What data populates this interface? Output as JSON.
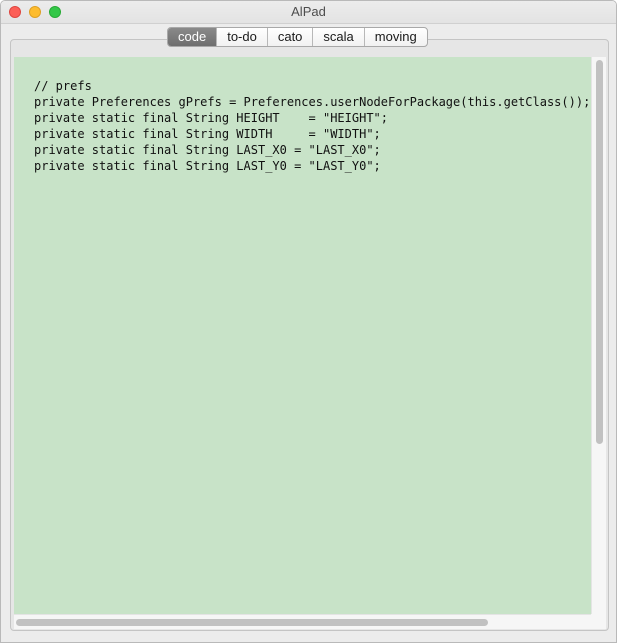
{
  "window": {
    "title": "AlPad"
  },
  "tabs": [
    {
      "label": "code",
      "active": true
    },
    {
      "label": "to-do",
      "active": false
    },
    {
      "label": "cato",
      "active": false
    },
    {
      "label": "scala",
      "active": false
    },
    {
      "label": "moving",
      "active": false
    }
  ],
  "editor": {
    "lines": [
      "// prefs",
      "private Preferences gPrefs = Preferences.userNodeForPackage(this.getClass());",
      "private static final String HEIGHT    = \"HEIGHT\";",
      "private static final String WIDTH     = \"WIDTH\";",
      "private static final String LAST_X0 = \"LAST_X0\";",
      "private static final String LAST_Y0 = \"LAST_Y0\";"
    ],
    "background_color": "#c8e3c8"
  },
  "colors": {
    "close": "#fc5f57",
    "minimize": "#fdbc2e",
    "maximize": "#33c748",
    "active_tab": "#7a7a7a"
  }
}
